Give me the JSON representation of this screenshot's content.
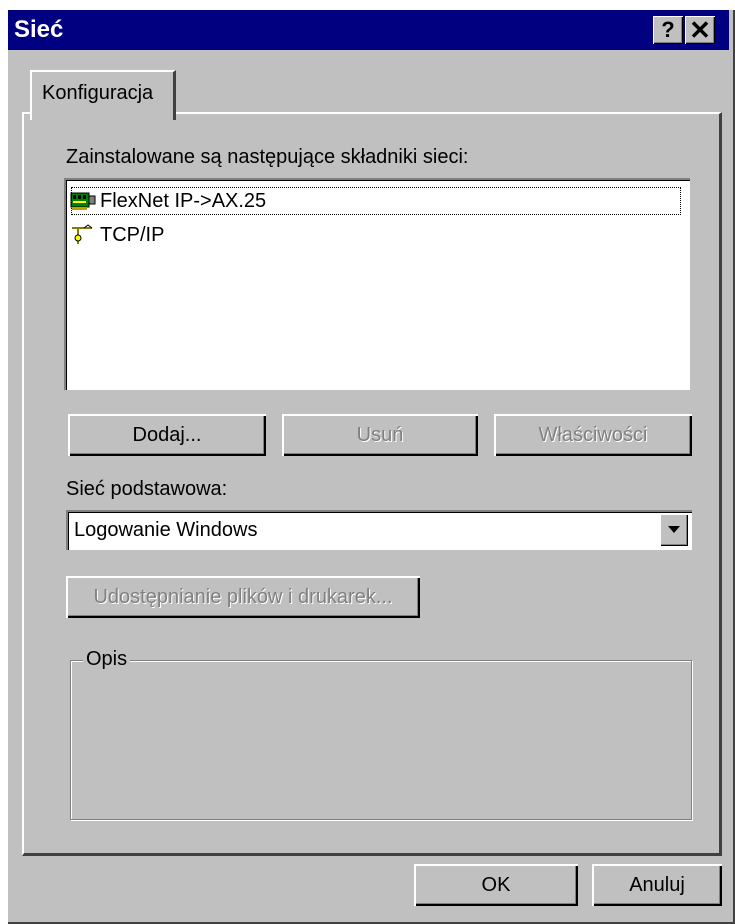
{
  "window": {
    "title": "Sieć",
    "help_glyph": "?",
    "close_glyph": "✕"
  },
  "tabs": [
    {
      "label": "Konfiguracja"
    }
  ],
  "components": {
    "label": "Zainstalowane są następujące składniki sieci:",
    "items": [
      {
        "label": "FlexNet IP->AX.25",
        "icon": "network-adapter-icon"
      },
      {
        "label": "TCP/IP",
        "icon": "protocol-icon"
      }
    ]
  },
  "buttons": {
    "add": "Dodaj...",
    "remove": "Usuń",
    "properties": "Właściwości",
    "file_sharing": "Udostępnianie plików i drukarek...",
    "ok": "OK",
    "cancel": "Anuluj"
  },
  "primary_network": {
    "label": "Sieć podstawowa:",
    "value": "Logowanie Windows"
  },
  "description": {
    "title": "Opis"
  },
  "colors": {
    "titlebar": "#000080",
    "face": "#c0c0c0",
    "disabled_text": "#808080"
  }
}
